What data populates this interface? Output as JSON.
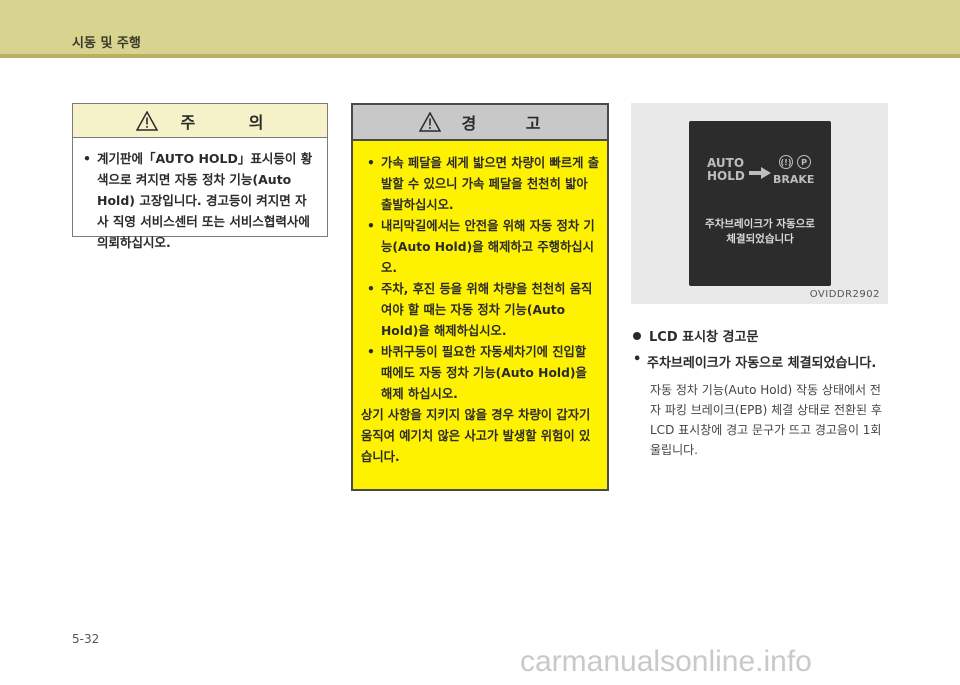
{
  "header": {
    "title": "시동 및 주행"
  },
  "caution": {
    "title": "주 의",
    "items": [
      "계기판에「AUTO HOLD」표시등이 황색으로 켜지면 자동 정차 기능(Auto Hold) 고장입니다. 경고등이 켜지면 자사 직영 서비스센터 또는 서비스협력사에 의뢰하십시오."
    ]
  },
  "warning": {
    "title": "경 고",
    "items": [
      "가속 페달을 세게 밟으면 차량이 빠르게 출발할 수 있으니 가속 페달을 천천히 밟아 출발하십시오.",
      "내리막길에서는 안전을 위해 자동 정차 기능(Auto Hold)을 해제하고 주행하십시오.",
      "주차, 후진 등을 위해 차량을 천천히 움직여야 할 때는 자동 정차 기능(Auto Hold)을 해제하십시오.",
      "바퀴구동이 필요한 자동세차기에 진입할 때에도 자동 정차 기능(Auto Hold)을 해제 하십시오."
    ],
    "note": "상기 사항을 지키지 않을 경우 차량이 갑자기 움직여 예기치 않은 사고가 발생할 위험이 있습니다."
  },
  "figure": {
    "lcd_auto_line1": "AUTO",
    "lcd_auto_line2": "HOLD",
    "lcd_ring1": "(!)",
    "lcd_ring2": "P",
    "lcd_brake": "BRAKE",
    "lcd_msg_line1": "주차브레이크가 자동으로",
    "lcd_msg_line2": "체결되었습니다",
    "code": "OVIDDR2902"
  },
  "section": {
    "title": "LCD 표시창 경고문",
    "message": "주차브레이크가 자동으로 체결되었습니다.",
    "description": "자동 정차 기능(Auto Hold) 작동 상태에서 전자 파킹 브레이크(EPB) 체결 상태로 전환된 후 LCD 표시창에 경고 문구가 뜨고 경고음이 1회 울립니다."
  },
  "page_number": "5-32",
  "watermark": "carmanualsonline.info"
}
